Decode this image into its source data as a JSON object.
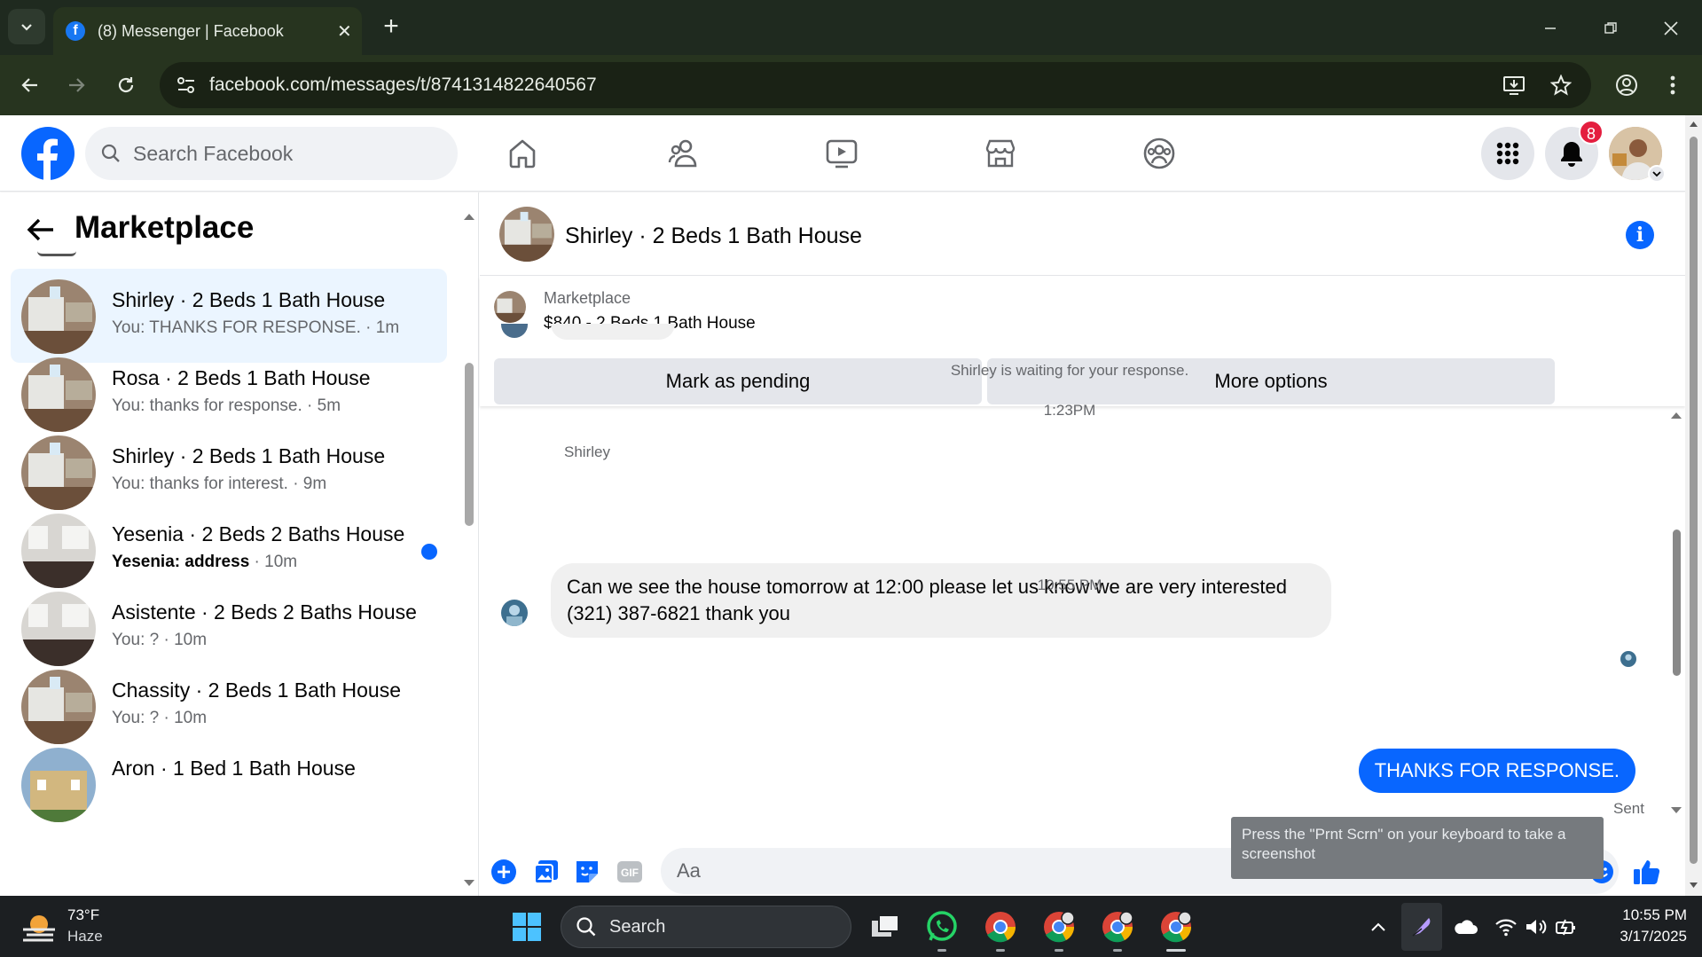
{
  "browser": {
    "tab_title": "(8) Messenger | Facebook",
    "url": "facebook.com/messages/t/8741314822640567"
  },
  "facebook": {
    "search_placeholder": "Search Facebook",
    "notification_count": "8"
  },
  "sidebar": {
    "title": "Marketplace",
    "conversations": [
      {
        "name": "Shirley · 2 Beds 1 Bath House",
        "preview": "You: THANKS FOR RESPONSE. · 1m",
        "active": true,
        "unread": false
      },
      {
        "name": "Rosa · 2 Beds 1 Bath House",
        "preview": "You: thanks for response. · 5m",
        "active": false,
        "unread": false
      },
      {
        "name": "Shirley · 2 Beds 1 Bath House",
        "preview": "You: thanks for interest. · 9m",
        "active": false,
        "unread": false
      },
      {
        "name": "Yesenia · 2 Beds 2 Baths House",
        "preview_bold": "Yesenia: address",
        "preview_time": " · 10m",
        "active": false,
        "unread": true
      },
      {
        "name": "Asistente · 2 Beds 2 Baths House",
        "preview": "You: ? · 10m",
        "active": false,
        "unread": false
      },
      {
        "name": "Chassity · 2 Beds 1 Bath House",
        "preview": "You: ? · 10m",
        "active": false,
        "unread": false
      },
      {
        "name": "Aron · 1 Bed 1 Bath House",
        "preview": "",
        "active": false,
        "unread": false
      }
    ]
  },
  "chat": {
    "title": "Shirley · 2 Beds 1 Bath House",
    "listing_label": "Marketplace",
    "listing_price": "$840 - 2 Beds 1 Bath House",
    "mark_pending_label": "Mark as pending",
    "more_options_label": "More options",
    "waiting_notice": "Shirley is waiting for your response.",
    "time_1": "1:23PM",
    "sender_name": "Shirley",
    "incoming_message": "Can we see the house tomorrow  at 12:00 please let us know we are very interested (321) 387-6821 thank you",
    "time_2": "10:55 PM",
    "outgoing_message": "THANKS FOR RESPONSE.",
    "sent_status": "Sent",
    "input_placeholder": "Aa",
    "tooltip": "Press the \"Prnt Scrn\" on your keyboard to take a screenshot"
  },
  "taskbar": {
    "temperature": "73°F",
    "weather": "Haze",
    "search_label": "Search",
    "time": "10:55 PM",
    "date": "3/17/2025"
  },
  "colors": {
    "facebook_blue": "#0866ff",
    "chrome_dark": "#27341f",
    "badge_red": "#e41e3f"
  }
}
